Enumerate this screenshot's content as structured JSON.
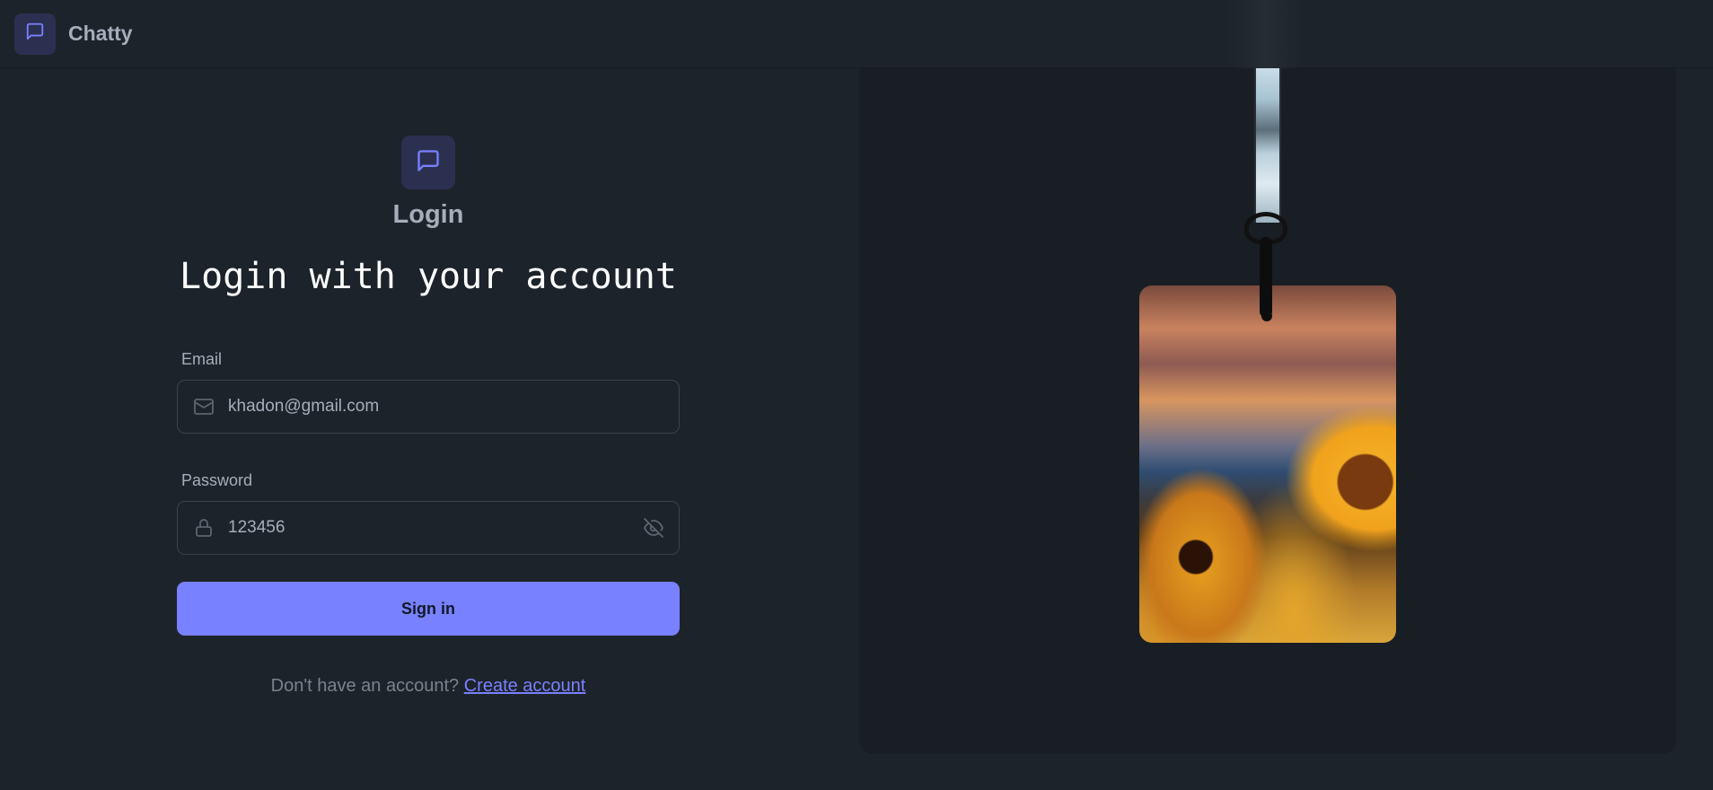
{
  "app": {
    "name": "Chatty"
  },
  "form": {
    "title": "Login",
    "subtitle": "Login with your account",
    "email": {
      "label": "Email",
      "value": "khadon@gmail.com"
    },
    "password": {
      "label": "Password",
      "value": "123456"
    },
    "submit_label": "Sign in",
    "footer_text": "Don't have an account?",
    "footer_link": "Create account"
  },
  "icons": {
    "logo": "message-square-icon",
    "email": "mail-icon",
    "password": "lock-icon",
    "toggle": "eye-off-icon"
  },
  "colors": {
    "background": "#1d232a",
    "accent": "#7881ff",
    "logo_bg": "#2c3050",
    "panel": "#191e24"
  }
}
